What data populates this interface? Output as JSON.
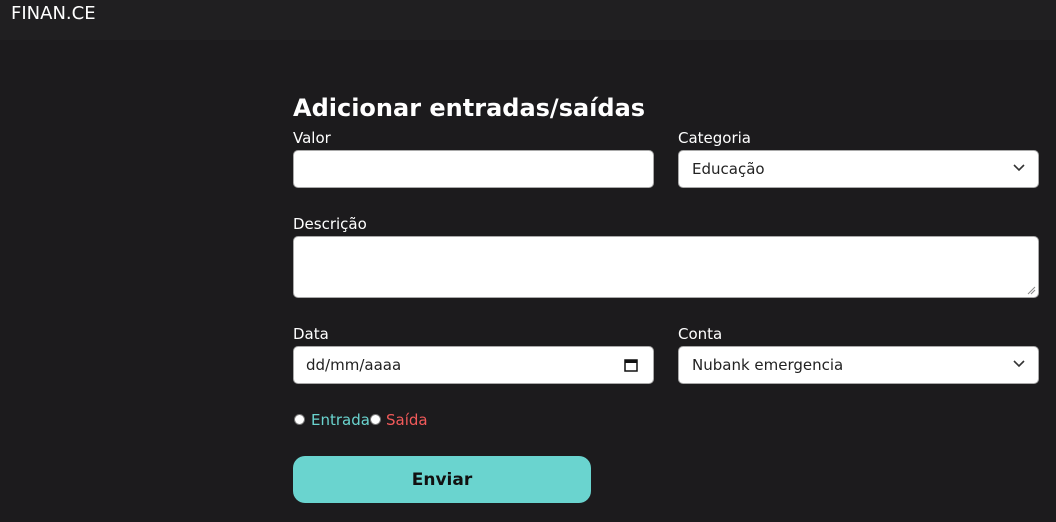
{
  "header": {
    "brand": "FINAN.CE"
  },
  "form": {
    "title": "Adicionar entradas/saídas",
    "valor_label": "Valor",
    "valor_value": "",
    "categoria_label": "Categoria",
    "categoria_selected": "Educação",
    "descricao_label": "Descrição",
    "descricao_value": "",
    "data_label": "Data",
    "data_placeholder": "dd/mm/aaaa",
    "conta_label": "Conta",
    "conta_selected": "Nubank emergencia",
    "radio_entrada": "Entrada",
    "radio_saida": "Saída",
    "submit_label": "Enviar"
  },
  "colors": {
    "background": "#1c1b1d",
    "accent": "#6ad4cf",
    "entrada": "#6ad4cf",
    "saida": "#f25a5a"
  },
  "icons": {
    "select_chevron": "chevron-down-icon",
    "date_picker": "calendar-icon"
  }
}
